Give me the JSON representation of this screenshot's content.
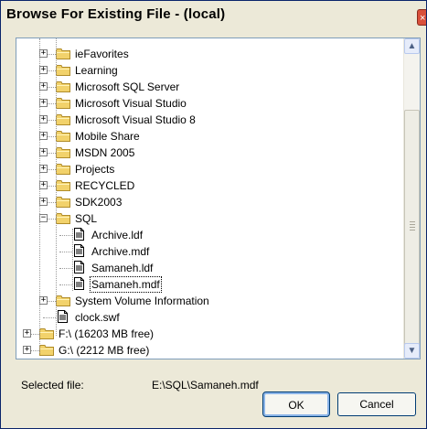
{
  "window": {
    "title": "Browse For Existing File - (local)",
    "close_glyph": "×"
  },
  "tree": {
    "items": [
      {
        "label": "ieFavorites",
        "type": "folder",
        "expander": "+"
      },
      {
        "label": "Learning",
        "type": "folder",
        "expander": "+"
      },
      {
        "label": "Microsoft SQL Server",
        "type": "folder",
        "expander": "+"
      },
      {
        "label": "Microsoft Visual Studio",
        "type": "folder",
        "expander": "+"
      },
      {
        "label": "Microsoft Visual Studio 8",
        "type": "folder",
        "expander": "+"
      },
      {
        "label": "Mobile Share",
        "type": "folder",
        "expander": "+"
      },
      {
        "label": "MSDN 2005",
        "type": "folder",
        "expander": "+"
      },
      {
        "label": "Projects",
        "type": "folder",
        "expander": "+"
      },
      {
        "label": "RECYCLED",
        "type": "folder",
        "expander": "+"
      },
      {
        "label": "SDK2003",
        "type": "folder",
        "expander": "+"
      },
      {
        "label": "SQL",
        "type": "folder",
        "expander": "−"
      },
      {
        "label": "Archive.ldf",
        "type": "file"
      },
      {
        "label": "Archive.mdf",
        "type": "file"
      },
      {
        "label": "Samaneh.ldf",
        "type": "file"
      },
      {
        "label": "Samaneh.mdf",
        "type": "file",
        "selected": true
      },
      {
        "label": "System Volume Information",
        "type": "folder",
        "expander": "+"
      },
      {
        "label": "clock.swf",
        "type": "file"
      },
      {
        "label": "F:\\ (16203 MB free)",
        "type": "drive",
        "expander": "+"
      },
      {
        "label": "G:\\ (2212 MB free)",
        "type": "drive",
        "expander": "+"
      }
    ]
  },
  "scrollbar": {
    "up_glyph": "▲",
    "down_glyph": "▼"
  },
  "selected_file": {
    "label": "Selected file:",
    "value": "E:\\SQL\\Samaneh.mdf"
  },
  "buttons": {
    "ok": "OK",
    "cancel": "Cancel"
  },
  "colors": {
    "folder": "#f2d26b",
    "folder_edge": "#b08c2a",
    "tree_border": "#7f9db9",
    "dialog_bg": "#ece9d8"
  }
}
